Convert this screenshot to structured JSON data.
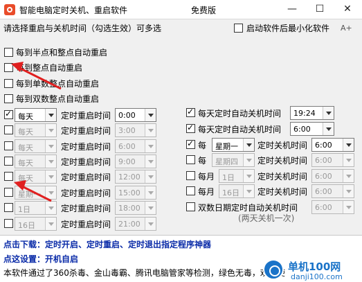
{
  "window": {
    "title": "智能电脑定时关机、重启软件",
    "subtitle": "免费版",
    "minimize": "—",
    "maximize": "☐",
    "close": "✕"
  },
  "instruction": "请选择重启与关机时间（勾选生效）可多选",
  "startup_minimize": {
    "label": "启动软件后最小化软件",
    "checked": false
  },
  "font_button": "A+",
  "quick_restart": [
    {
      "label": "每到半点和整点自动重启",
      "checked": false
    },
    {
      "label": "每到整点自动重启",
      "checked": false
    },
    {
      "label": "每到单数整点自动重启",
      "checked": false
    },
    {
      "label": "每到双数整点自动重启",
      "checked": false
    }
  ],
  "restart_label": "定时重启时间",
  "restart_rows": [
    {
      "checked": true,
      "freq": "每天",
      "time": "0:00",
      "enabled": true
    },
    {
      "checked": false,
      "freq": "每天",
      "time": "3:00",
      "enabled": false
    },
    {
      "checked": false,
      "freq": "每天",
      "time": "6:00",
      "enabled": false
    },
    {
      "checked": false,
      "freq": "每天",
      "time": "9:00",
      "enabled": false
    },
    {
      "checked": false,
      "freq": "每天",
      "time": "12:00",
      "enabled": false
    },
    {
      "checked": false,
      "freq": "星期一",
      "time": "15:00",
      "enabled": false
    },
    {
      "checked": false,
      "freq": "1日",
      "time": "18:00",
      "enabled": false
    },
    {
      "checked": false,
      "freq": "16日",
      "time": "21:00",
      "enabled": false
    }
  ],
  "shutdown_rows": [
    {
      "checked": true,
      "label": "每天定时自动关机时间",
      "time": "19:24",
      "enabled": true
    },
    {
      "checked": true,
      "label": "每天定时自动关机时间",
      "time": "6:00",
      "enabled": true
    },
    {
      "checked": true,
      "prefix": "每",
      "freq": "星期一",
      "label": "定时关机时间",
      "time": "6:00",
      "enabled": true
    },
    {
      "checked": false,
      "prefix": "每",
      "freq": "星期四",
      "label": "定时关机时间",
      "time": "6:00",
      "enabled": false
    },
    {
      "checked": false,
      "prefix": "每月",
      "freq": "1日",
      "label": "定时关机时间",
      "time": "6:00",
      "enabled": false
    },
    {
      "checked": false,
      "prefix": "每月",
      "freq": "16日",
      "label": "定时关机时间",
      "time": "6:00",
      "enabled": false
    },
    {
      "checked": false,
      "label": "双数日期定时自动关机时间",
      "time": "6:00",
      "enabled": false
    }
  ],
  "note": "(两天关机一次)",
  "bottom": {
    "download": "点击下载：定时开启、定时重启、定时退出指定程序神器",
    "setting": "点这设置：开机自启",
    "info": "本软件通过了360杀毒、金山毒霸、腾讯电脑管家等检测，绿色无毒，欢迎使"
  },
  "watermark": {
    "name": "单机100网",
    "url": "danji100.com"
  },
  "colors": {
    "link": "#0a2ba8",
    "annotation_arrow": "#e02020",
    "titlebar": "#ffffff"
  }
}
